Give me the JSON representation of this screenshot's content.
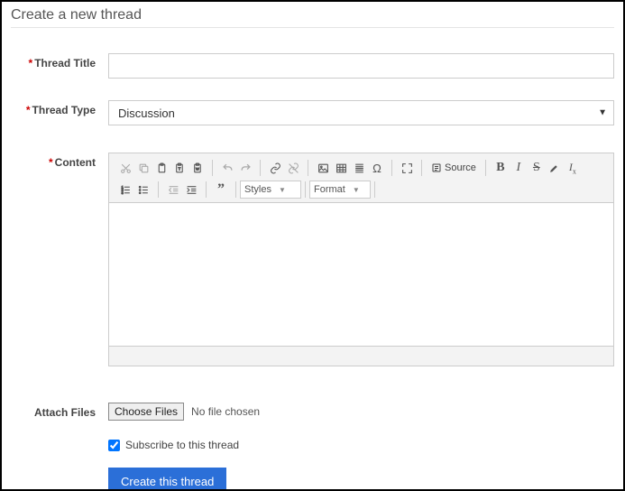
{
  "header": {
    "title": "Create a new thread"
  },
  "labels": {
    "title": "Thread Title",
    "type": "Thread Type",
    "content": "Content",
    "attach": "Attach Files"
  },
  "type_select": {
    "selected": "Discussion"
  },
  "editor_toolbar": {
    "source_label": "Source",
    "styles_label": "Styles",
    "format_label": "Format"
  },
  "attach": {
    "button": "Choose Files",
    "status": "No file chosen"
  },
  "subscribe": {
    "label": "Subscribe to this thread",
    "checked": true
  },
  "submit": {
    "label": "Create this thread"
  }
}
